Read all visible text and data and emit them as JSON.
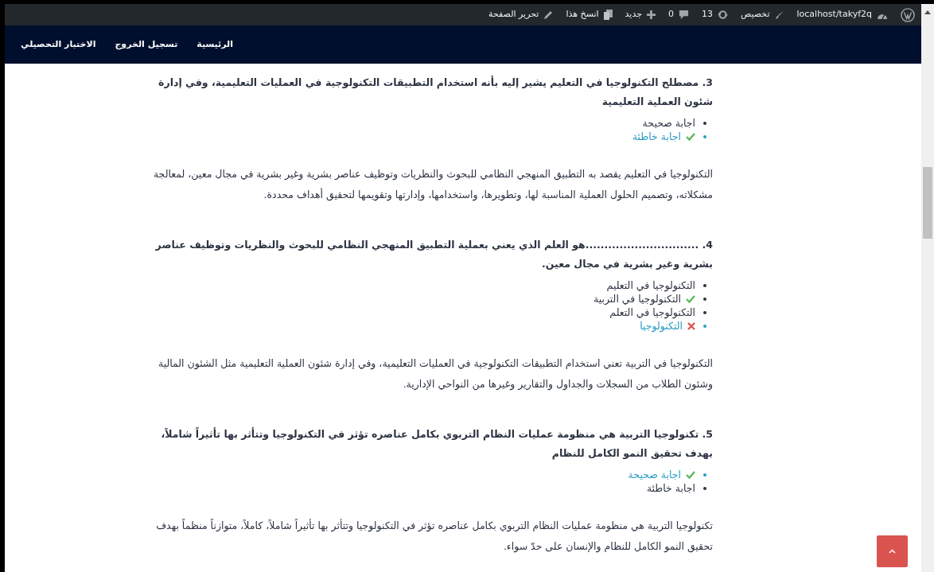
{
  "admin_bar": {
    "site": "localhost/takyf2q",
    "customize": "تخصيص",
    "updates": "13",
    "comments": "0",
    "new": "جديد",
    "copy": "انسخ هذا",
    "edit": "تحرير الصفحة"
  },
  "nav": {
    "items": [
      "الرئيسية",
      "تسجيل الخروج",
      "الاختبار التحصيلي"
    ]
  },
  "questions": [
    {
      "text": "3. مصطلح التكنولوجيا في التعليم يشير إليه بأنه استخدام التطبيقات التكنولوجية في العمليات التعليمية، وفي إدارة شئون العملية التعليمية",
      "answers": [
        {
          "text": "اجابة صحيحة",
          "kind": "plain",
          "selected": false
        },
        {
          "text": "اجابة خاطئة",
          "kind": "correct",
          "selected": true
        }
      ],
      "explanation": "التكنولوجيا في التعليم يقصد به التطبيق المنهجي النظامي للبحوث والنظريات وتوظيف عناصر بشرية وغير بشرية في مجال معين، لمعالجة مشكلاته، وتصميم الحلول العملية المناسبة لها، وتطويرها، واستخدامها، وإدارتها وتقويمها لتحقيق أهداف محددة."
    },
    {
      "text": "4. ..............................هو العلم الذي يعني بعملية التطبيق المنهجي النظامي للبحوث والنظريات وتوظيف عناصر بشرية وغير بشرية في مجال معين.",
      "answers": [
        {
          "text": "التكنولوجيا في التعليم",
          "kind": "plain",
          "selected": false
        },
        {
          "text": "التكنولوجيا في التربية",
          "kind": "correct",
          "selected": false
        },
        {
          "text": "التكنولوجيا في التعلم",
          "kind": "plain",
          "selected": false
        },
        {
          "text": "التكنولوجيا",
          "kind": "wrong",
          "selected": true
        }
      ],
      "explanation": "التكنولوجيا في التربية تعني استخدام التطبيقات التكنولوجية في العمليات التعليمية، وفي إدارة شئون العملية التعليمية مثل الشئون المالية وشئون الطلاب من السجلات والجداول والتقارير وغيرها من النواحي الإدارية."
    },
    {
      "text": "5. تكنولوجيا التربية هي منظومة عمليات النظام التربوي بكامل عناصره تؤثر في التكنولوجيا وتتأثر بها تأثيراً شاملاً، بهدف تحقيق النمو الكامل للنظام",
      "answers": [
        {
          "text": "اجابة صحيحة",
          "kind": "correct",
          "selected": true
        },
        {
          "text": "اجابة خاطئة",
          "kind": "plain",
          "selected": false
        }
      ],
      "explanation": "تكنولوجيا التربية هي منظومة عمليات النظام التربوي بكامل عناصره تؤثر في التكنولوجيا وتتأثر بها تأثيراً شاملاً، كاملاً، متوازناً منظماً بهدف تحقيق النمو الكامل للنظام والإنسان على حدّ سواء."
    }
  ]
}
